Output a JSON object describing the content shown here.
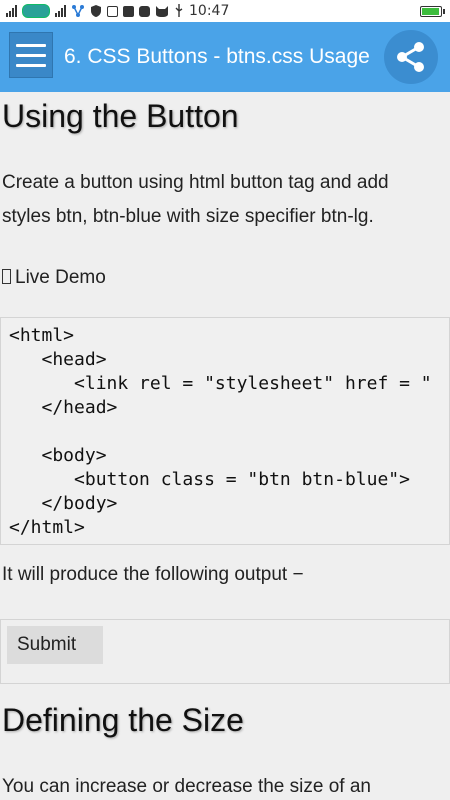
{
  "status_bar": {
    "time": "10:47",
    "battery_level": 0.85,
    "icons": [
      "signal-icon",
      "carrier-logo-icon",
      "signal-icon",
      "network-icon",
      "shield-icon",
      "instagram-icon",
      "facebook-icon",
      "zalo-icon",
      "cat-icon",
      "usb-icon",
      "battery-icon"
    ]
  },
  "app_bar": {
    "title": "6. CSS Buttons - btns.css Usage",
    "menu_icon": "hamburger-menu-icon",
    "share_icon": "share-icon",
    "color": "#4aa3e8"
  },
  "content": {
    "heading1": "Using the Button",
    "para1_line1": "Create a button using html button tag and add",
    "para1_line2": "styles btn, btn-blue with size specifier btn-lg.",
    "live_demo": "Live Demo",
    "code_lines": [
      "<html>",
      "   <head>",
      "      <link rel = \"stylesheet\" href = \"",
      "   </head>",
      "",
      "   <body>",
      "      <button class = \"btn btn-blue\">",
      "   </body>",
      "</html>"
    ],
    "output_text": "It will produce the following output −",
    "submit_label": "Submit",
    "heading2": "Defining the Size",
    "para2_line1": "You can increase or decrease the size of an"
  }
}
